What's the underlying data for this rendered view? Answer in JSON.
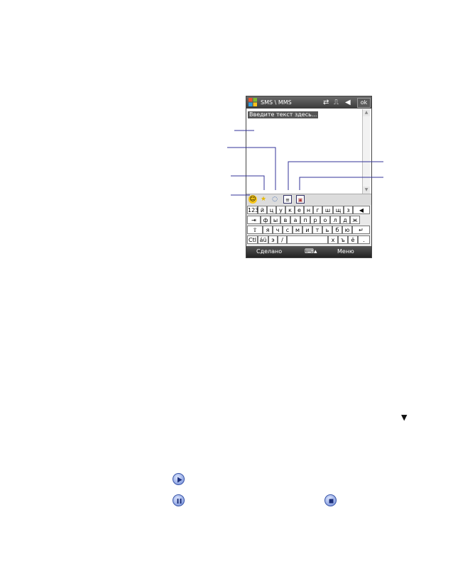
{
  "device": {
    "title": "SMS \\ MMS",
    "ok_label": "ok",
    "placeholder": "Введите текст здесь...",
    "softkeys": {
      "left": "Сделано",
      "right": "Меню"
    },
    "status_icons": [
      "sync-icon",
      "signal-icon",
      "volume-icon"
    ],
    "toolbar_icons": [
      "smiley-icon",
      "favorite-star-icon",
      "message-bubble-icon",
      "template-icon",
      "picture-icon"
    ]
  },
  "keyboard": {
    "row1": [
      "123",
      "й",
      "ц",
      "у",
      "к",
      "е",
      "н",
      "г",
      "ш",
      "щ",
      "з",
      "◀"
    ],
    "row2": [
      "⇥",
      "ф",
      "ы",
      "в",
      "а",
      "п",
      "р",
      "о",
      "л",
      "д",
      "ж"
    ],
    "row3": [
      "⇧",
      "я",
      "ч",
      "с",
      "м",
      "и",
      "т",
      "ь",
      "б",
      "ю",
      "↵"
    ],
    "row4": [
      "Ctl",
      "áü",
      "э",
      "/",
      " ",
      "х",
      "ъ",
      "ё",
      "."
    ]
  },
  "page": {
    "expand_arrow": "▼"
  },
  "media_icons": {
    "play": "play-icon",
    "pause": "pause-icon",
    "stop": "stop-icon"
  }
}
